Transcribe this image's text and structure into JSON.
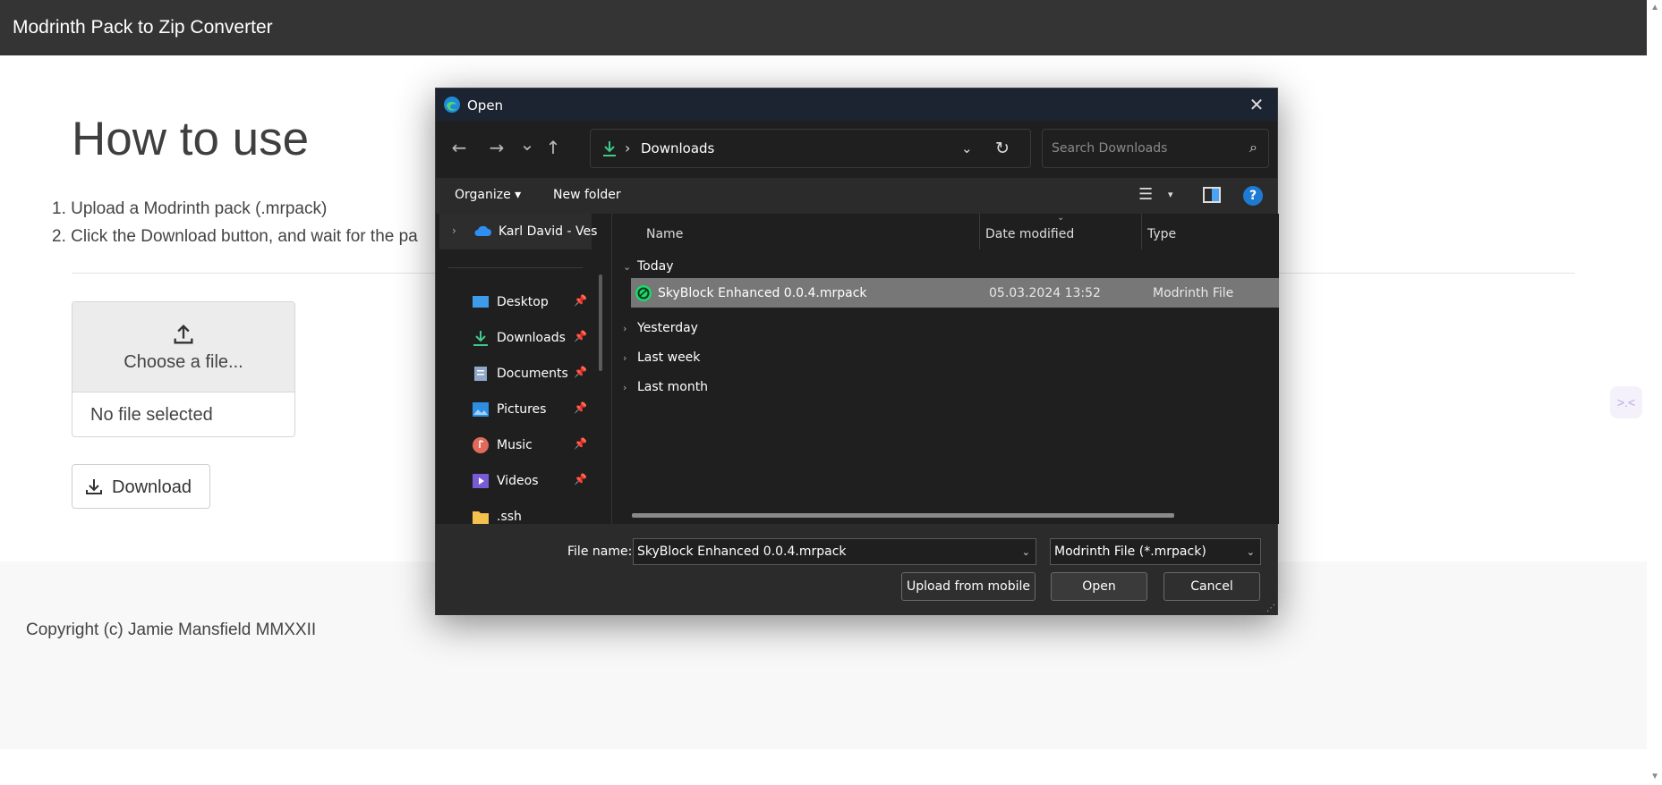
{
  "page": {
    "brand": "Modrinth Pack to Zip Converter",
    "title": "How to use",
    "steps": [
      "1. Upload a Modrinth pack (.mrpack)",
      "2. Click the Download button, and wait for the pa"
    ],
    "choose_label": "Choose a file...",
    "no_file": "No file selected",
    "download_label": "Download",
    "footer": "Copyright (c) Jamie Mansfield MMXXII",
    "side_widget": ">.<"
  },
  "dialog": {
    "title": "Open",
    "close": "✕",
    "nav": {
      "back": "←",
      "forward": "→",
      "recent": "⌄",
      "up": "↑"
    },
    "address": {
      "sep": "›",
      "path": "Downloads",
      "chevron": "⌄",
      "refresh": "↻"
    },
    "search": {
      "placeholder": "Search Downloads",
      "icon": "⌕"
    },
    "toolbar": {
      "organize": "Organize ▾",
      "new_folder": "New folder",
      "view_dd": "▾",
      "help": "?"
    },
    "nav_pane": {
      "onedrive": "Karl David - Ves",
      "items": [
        {
          "label": "Desktop",
          "icon": "desktop-icon",
          "pin": "📌"
        },
        {
          "label": "Downloads",
          "icon": "downloads-icon",
          "pin": "📌"
        },
        {
          "label": "Documents",
          "icon": "documents-icon",
          "pin": "📌"
        },
        {
          "label": "Pictures",
          "icon": "pictures-icon",
          "pin": "📌"
        },
        {
          "label": "Music",
          "icon": "music-icon",
          "pin": "📌"
        },
        {
          "label": "Videos",
          "icon": "videos-icon",
          "pin": "📌"
        },
        {
          "label": ".ssh",
          "icon": "folder-icon",
          "pin": ""
        }
      ]
    },
    "columns": {
      "name": "Name",
      "date": "Date modified",
      "type": "Type"
    },
    "groups": {
      "today": "Today",
      "yesterday": "Yesterday",
      "last_week": "Last week",
      "last_month": "Last month"
    },
    "file": {
      "name": "SkyBlock Enhanced 0.0.4.mrpack",
      "date": "05.03.2024 13:52",
      "type": "Modrinth File"
    },
    "bottom": {
      "file_name_label": "File name:",
      "file_name_value": "SkyBlock Enhanced 0.0.4.mrpack",
      "filter_value": "Modrinth File (*.mrpack)",
      "upload_label": "Upload from mobile",
      "open_label": "Open",
      "cancel_label": "Cancel"
    }
  },
  "colors": {
    "navbar": "#343434",
    "dialog_bg": "#1f1f1f",
    "selected_row": "#777777",
    "accent": "#4aa3f5"
  }
}
